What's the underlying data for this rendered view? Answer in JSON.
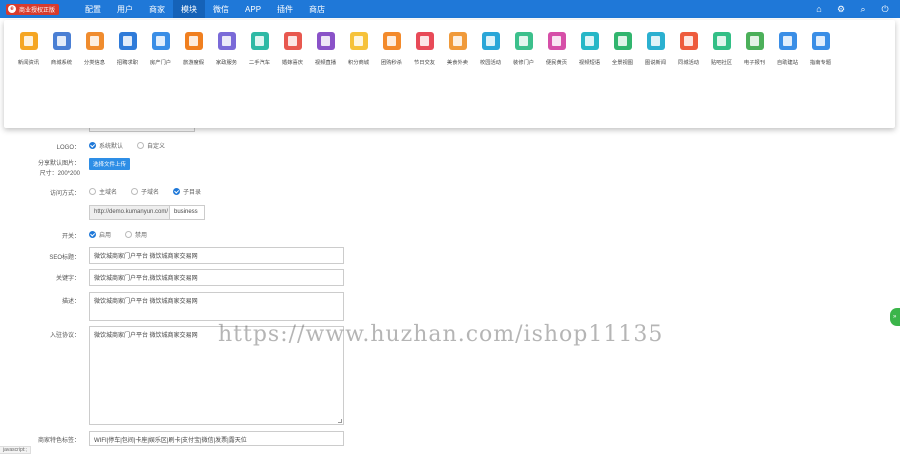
{
  "brand": {
    "logo_text": "商业授权正版"
  },
  "nav": {
    "items": [
      "配置",
      "用户",
      "商家",
      "模块",
      "微信",
      "APP",
      "插件",
      "商店"
    ],
    "active_index": 3
  },
  "top_icons": [
    "home-icon",
    "gear-icon",
    "search-icon",
    "power-icon"
  ],
  "modules": [
    {
      "label": "新闻资讯",
      "color": "#f5a623"
    },
    {
      "label": "商城系统",
      "color": "#4a7fd4"
    },
    {
      "label": "分类信息",
      "color": "#f08c2e"
    },
    {
      "label": "招聘求职",
      "color": "#2f7bd9"
    },
    {
      "label": "房产门户",
      "color": "#3a8ee6"
    },
    {
      "label": "旅游度假",
      "color": "#f07f1f"
    },
    {
      "label": "家政服务",
      "color": "#7a6ad8"
    },
    {
      "label": "二手汽车",
      "color": "#2eb9a5"
    },
    {
      "label": "婚嫁喜庆",
      "color": "#e8584f"
    },
    {
      "label": "视频直播",
      "color": "#8a52c8"
    },
    {
      "label": "积分商城",
      "color": "#f6c23a"
    },
    {
      "label": "团购秒杀",
      "color": "#f38a2b"
    },
    {
      "label": "节日交友",
      "color": "#e84a58"
    },
    {
      "label": "美食外卖",
      "color": "#f09a3a"
    },
    {
      "label": "校园活动",
      "color": "#2aa6d8"
    },
    {
      "label": "装修门户",
      "color": "#3cc08c"
    },
    {
      "label": "便民黄页",
      "color": "#d64fa8"
    },
    {
      "label": "视频短语",
      "color": "#26b7c7"
    },
    {
      "label": "全景视图",
      "color": "#31b56e"
    },
    {
      "label": "图说新闻",
      "color": "#2bb0d0"
    },
    {
      "label": "同城活动",
      "color": "#ee5b3d"
    },
    {
      "label": "贴吧社区",
      "color": "#32bf86"
    },
    {
      "label": "电子报刊",
      "color": "#4cb05a"
    },
    {
      "label": "自助建站",
      "color": "#3a8ee6"
    },
    {
      "label": "指南专题",
      "color": "#3a8ee6"
    }
  ],
  "form": {
    "logo": {
      "label": "LOGO：",
      "options": [
        "系统默认",
        "自定义"
      ],
      "selected": 0
    },
    "share_image": {
      "label": "分享默认图片：",
      "size_hint": "尺寸：200*200",
      "button": "选择文件上传"
    },
    "access": {
      "label": "访问方式：",
      "options": [
        "主域名",
        "子域名",
        "子目录"
      ],
      "selected": 2,
      "url_prefix": "http://demo.kumanyun.com/",
      "dir_value": "business"
    },
    "switch": {
      "label": "开关：",
      "options": [
        "启用",
        "禁用"
      ],
      "selected": 0
    },
    "seo_title": {
      "label": "SEO标题：",
      "value": "微饮城商家门户平台 微饮城商家交易网"
    },
    "keywords": {
      "label": "关键字：",
      "value": "微饮城商家门户平台,微饮城商家交易网"
    },
    "description": {
      "label": "描述：",
      "value": "微饮城商家门户平台 微饮城商家交易网"
    },
    "agreement": {
      "label": "入驻协议：",
      "value": "微饮城商家门户平台 微饮城商家交易网"
    },
    "tags": {
      "label": "商家特色标签：",
      "value": "WIFI|停车|包间|卡座|娱乐区|刷卡|支付宝|微信|发票|露天位"
    }
  },
  "watermark": "https://www.huzhan.com/ishop11135",
  "side_tab": "»",
  "status_text": "javascript:;"
}
